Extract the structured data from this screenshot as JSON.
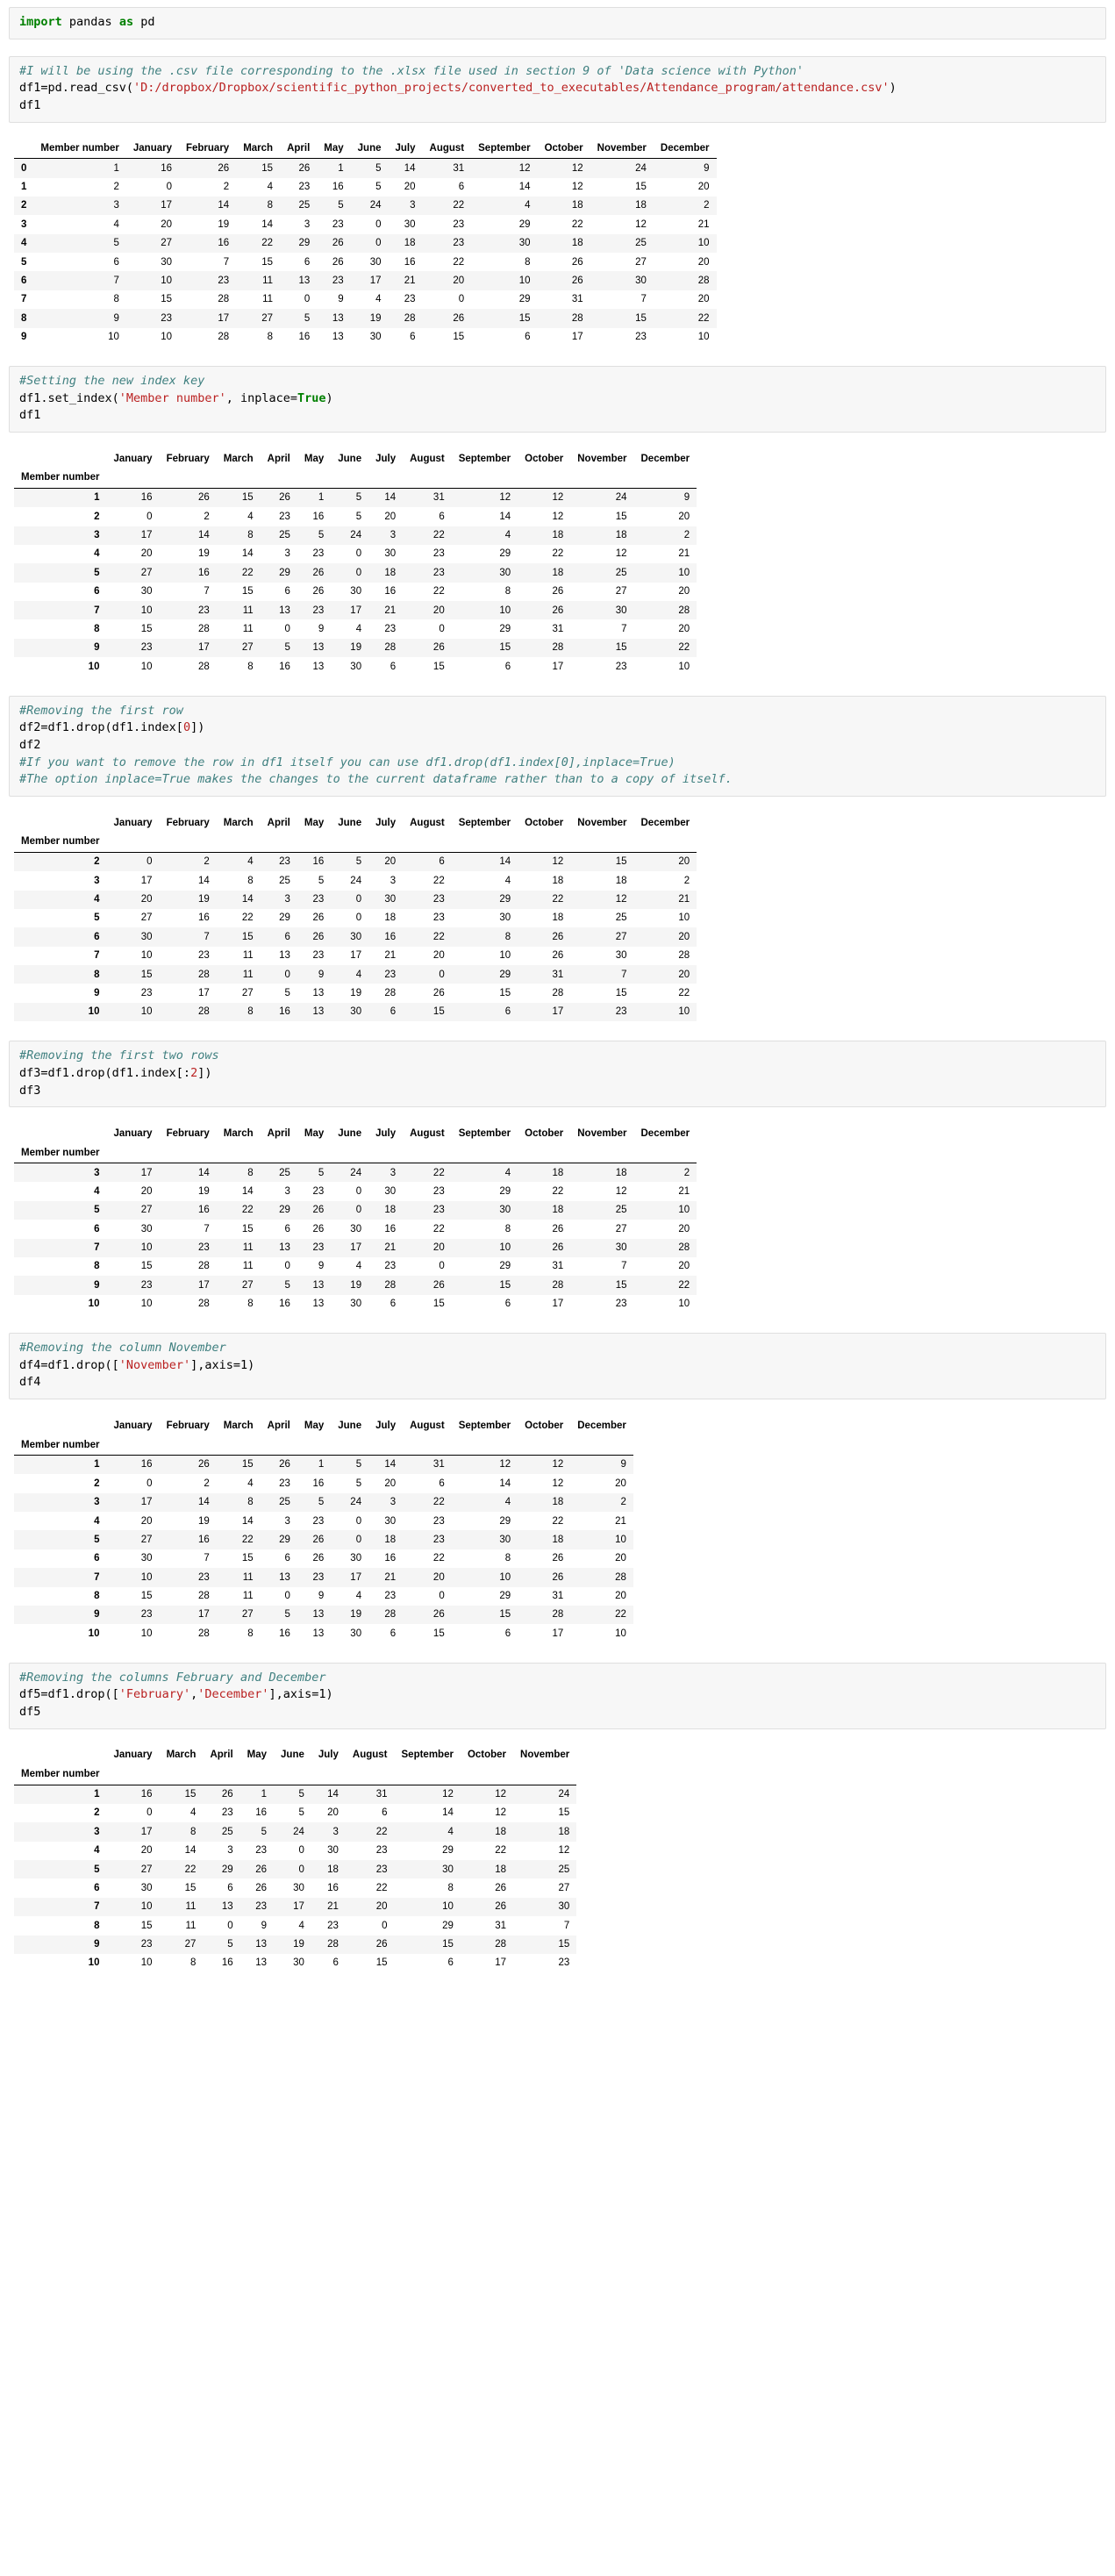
{
  "cells": [
    {
      "id": "cell-import",
      "lines": [
        {
          "segments": [
            {
              "t": "import",
              "c": "kw"
            },
            {
              "t": " pandas ",
              "c": ""
            },
            {
              "t": "as",
              "c": "kw"
            },
            {
              "t": " pd",
              "c": ""
            }
          ]
        }
      ]
    },
    {
      "id": "cell-readcsv",
      "lines": [
        {
          "segments": [
            {
              "t": "#I will be using the .csv file corresponding to the .xlsx file used in section 9 of 'Data science with Python'",
              "c": "cm"
            }
          ]
        },
        {
          "segments": [
            {
              "t": "df1=pd.read_csv(",
              "c": ""
            },
            {
              "t": "'D:/dropbox/Dropbox/scientific_python_projects/converted_to_executables/Attendance_program/attendance.csv'",
              "c": "st"
            },
            {
              "t": ")",
              "c": ""
            }
          ]
        },
        {
          "segments": [
            {
              "t": "df1",
              "c": ""
            }
          ]
        }
      ]
    },
    {
      "id": "cell-setindex",
      "lines": [
        {
          "segments": [
            {
              "t": "#Setting the new index key",
              "c": "cm"
            }
          ]
        },
        {
          "segments": [
            {
              "t": "df1.set_index(",
              "c": ""
            },
            {
              "t": "'Member number'",
              "c": "st"
            },
            {
              "t": ", inplace=",
              "c": ""
            },
            {
              "t": "True",
              "c": "kw"
            },
            {
              "t": ")",
              "c": ""
            }
          ]
        },
        {
          "segments": [
            {
              "t": "df1",
              "c": ""
            }
          ]
        }
      ]
    },
    {
      "id": "cell-droprow",
      "lines": [
        {
          "segments": [
            {
              "t": "#Removing the first row",
              "c": "cm"
            }
          ]
        },
        {
          "segments": [
            {
              "t": "df2=df1.drop(df1.index[",
              "c": ""
            },
            {
              "t": "0",
              "c": "st"
            },
            {
              "t": "])",
              "c": ""
            }
          ]
        },
        {
          "segments": [
            {
              "t": "df2",
              "c": ""
            }
          ]
        },
        {
          "segments": [
            {
              "t": "#If you want to remove the row in df1 itself you can use df1.drop(df1.index[0],inplace=True)",
              "c": "cm"
            }
          ]
        },
        {
          "segments": [
            {
              "t": "#The option inplace=True makes the changes to the current dataframe rather than to a copy of itself.",
              "c": "cm"
            }
          ]
        }
      ]
    },
    {
      "id": "cell-droptworows",
      "lines": [
        {
          "segments": [
            {
              "t": "#Removing the first two rows",
              "c": "cm"
            }
          ]
        },
        {
          "segments": [
            {
              "t": "df3=df1.drop(df1.index[:",
              "c": ""
            },
            {
              "t": "2",
              "c": "st"
            },
            {
              "t": "])",
              "c": ""
            }
          ]
        },
        {
          "segments": [
            {
              "t": "df3",
              "c": ""
            }
          ]
        }
      ]
    },
    {
      "id": "cell-dropcol",
      "lines": [
        {
          "segments": [
            {
              "t": "#Removing the column November",
              "c": "cm"
            }
          ]
        },
        {
          "segments": [
            {
              "t": "df4=df1.drop([",
              "c": ""
            },
            {
              "t": "'November'",
              "c": "st"
            },
            {
              "t": "],axis=1)",
              "c": ""
            }
          ]
        },
        {
          "segments": [
            {
              "t": "df4",
              "c": ""
            }
          ]
        }
      ]
    },
    {
      "id": "cell-droptwocols",
      "lines": [
        {
          "segments": [
            {
              "t": "#Removing the columns February and December",
              "c": "cm"
            }
          ]
        },
        {
          "segments": [
            {
              "t": "df5=df1.drop([",
              "c": ""
            },
            {
              "t": "'February'",
              "c": "st"
            },
            {
              "t": ",",
              "c": ""
            },
            {
              "t": "'December'",
              "c": "st"
            },
            {
              "t": "],axis=1)",
              "c": ""
            }
          ]
        },
        {
          "segments": [
            {
              "t": "df5",
              "c": ""
            }
          ]
        }
      ]
    }
  ],
  "tables": [
    {
      "id": "df1-raw",
      "index_name": null,
      "columns": [
        "Member number",
        "January",
        "February",
        "March",
        "April",
        "May",
        "June",
        "July",
        "August",
        "September",
        "October",
        "November",
        "December"
      ],
      "index": [
        "0",
        "1",
        "2",
        "3",
        "4",
        "5",
        "6",
        "7",
        "8",
        "9"
      ],
      "rows": [
        [
          1,
          16,
          26,
          15,
          26,
          1,
          5,
          14,
          31,
          12,
          12,
          24,
          9
        ],
        [
          2,
          0,
          2,
          4,
          23,
          16,
          5,
          20,
          6,
          14,
          12,
          15,
          20
        ],
        [
          3,
          17,
          14,
          8,
          25,
          5,
          24,
          3,
          22,
          4,
          18,
          18,
          2
        ],
        [
          4,
          20,
          19,
          14,
          3,
          23,
          0,
          30,
          23,
          29,
          22,
          12,
          21
        ],
        [
          5,
          27,
          16,
          22,
          29,
          26,
          0,
          18,
          23,
          30,
          18,
          25,
          10
        ],
        [
          6,
          30,
          7,
          15,
          6,
          26,
          30,
          16,
          22,
          8,
          26,
          27,
          20
        ],
        [
          7,
          10,
          23,
          11,
          13,
          23,
          17,
          21,
          20,
          10,
          26,
          30,
          28
        ],
        [
          8,
          15,
          28,
          11,
          0,
          9,
          4,
          23,
          0,
          29,
          31,
          7,
          20
        ],
        [
          9,
          23,
          17,
          27,
          5,
          13,
          19,
          28,
          26,
          15,
          28,
          15,
          22
        ],
        [
          10,
          10,
          28,
          8,
          16,
          13,
          30,
          6,
          15,
          6,
          17,
          23,
          10
        ]
      ]
    },
    {
      "id": "df1-indexed",
      "index_name": "Member number",
      "columns": [
        "January",
        "February",
        "March",
        "April",
        "May",
        "June",
        "July",
        "August",
        "September",
        "October",
        "November",
        "December"
      ],
      "index": [
        "1",
        "2",
        "3",
        "4",
        "5",
        "6",
        "7",
        "8",
        "9",
        "10"
      ],
      "rows": [
        [
          16,
          26,
          15,
          26,
          1,
          5,
          14,
          31,
          12,
          12,
          24,
          9
        ],
        [
          0,
          2,
          4,
          23,
          16,
          5,
          20,
          6,
          14,
          12,
          15,
          20
        ],
        [
          17,
          14,
          8,
          25,
          5,
          24,
          3,
          22,
          4,
          18,
          18,
          2
        ],
        [
          20,
          19,
          14,
          3,
          23,
          0,
          30,
          23,
          29,
          22,
          12,
          21
        ],
        [
          27,
          16,
          22,
          29,
          26,
          0,
          18,
          23,
          30,
          18,
          25,
          10
        ],
        [
          30,
          7,
          15,
          6,
          26,
          30,
          16,
          22,
          8,
          26,
          27,
          20
        ],
        [
          10,
          23,
          11,
          13,
          23,
          17,
          21,
          20,
          10,
          26,
          30,
          28
        ],
        [
          15,
          28,
          11,
          0,
          9,
          4,
          23,
          0,
          29,
          31,
          7,
          20
        ],
        [
          23,
          17,
          27,
          5,
          13,
          19,
          28,
          26,
          15,
          28,
          15,
          22
        ],
        [
          10,
          28,
          8,
          16,
          13,
          30,
          6,
          15,
          6,
          17,
          23,
          10
        ]
      ]
    },
    {
      "id": "df2",
      "index_name": "Member number",
      "columns": [
        "January",
        "February",
        "March",
        "April",
        "May",
        "June",
        "July",
        "August",
        "September",
        "October",
        "November",
        "December"
      ],
      "index": [
        "2",
        "3",
        "4",
        "5",
        "6",
        "7",
        "8",
        "9",
        "10"
      ],
      "rows": [
        [
          0,
          2,
          4,
          23,
          16,
          5,
          20,
          6,
          14,
          12,
          15,
          20
        ],
        [
          17,
          14,
          8,
          25,
          5,
          24,
          3,
          22,
          4,
          18,
          18,
          2
        ],
        [
          20,
          19,
          14,
          3,
          23,
          0,
          30,
          23,
          29,
          22,
          12,
          21
        ],
        [
          27,
          16,
          22,
          29,
          26,
          0,
          18,
          23,
          30,
          18,
          25,
          10
        ],
        [
          30,
          7,
          15,
          6,
          26,
          30,
          16,
          22,
          8,
          26,
          27,
          20
        ],
        [
          10,
          23,
          11,
          13,
          23,
          17,
          21,
          20,
          10,
          26,
          30,
          28
        ],
        [
          15,
          28,
          11,
          0,
          9,
          4,
          23,
          0,
          29,
          31,
          7,
          20
        ],
        [
          23,
          17,
          27,
          5,
          13,
          19,
          28,
          26,
          15,
          28,
          15,
          22
        ],
        [
          10,
          28,
          8,
          16,
          13,
          30,
          6,
          15,
          6,
          17,
          23,
          10
        ]
      ]
    },
    {
      "id": "df3",
      "index_name": "Member number",
      "columns": [
        "January",
        "February",
        "March",
        "April",
        "May",
        "June",
        "July",
        "August",
        "September",
        "October",
        "November",
        "December"
      ],
      "index": [
        "3",
        "4",
        "5",
        "6",
        "7",
        "8",
        "9",
        "10"
      ],
      "rows": [
        [
          17,
          14,
          8,
          25,
          5,
          24,
          3,
          22,
          4,
          18,
          18,
          2
        ],
        [
          20,
          19,
          14,
          3,
          23,
          0,
          30,
          23,
          29,
          22,
          12,
          21
        ],
        [
          27,
          16,
          22,
          29,
          26,
          0,
          18,
          23,
          30,
          18,
          25,
          10
        ],
        [
          30,
          7,
          15,
          6,
          26,
          30,
          16,
          22,
          8,
          26,
          27,
          20
        ],
        [
          10,
          23,
          11,
          13,
          23,
          17,
          21,
          20,
          10,
          26,
          30,
          28
        ],
        [
          15,
          28,
          11,
          0,
          9,
          4,
          23,
          0,
          29,
          31,
          7,
          20
        ],
        [
          23,
          17,
          27,
          5,
          13,
          19,
          28,
          26,
          15,
          28,
          15,
          22
        ],
        [
          10,
          28,
          8,
          16,
          13,
          30,
          6,
          15,
          6,
          17,
          23,
          10
        ]
      ]
    },
    {
      "id": "df4",
      "index_name": "Member number",
      "columns": [
        "January",
        "February",
        "March",
        "April",
        "May",
        "June",
        "July",
        "August",
        "September",
        "October",
        "December"
      ],
      "index": [
        "1",
        "2",
        "3",
        "4",
        "5",
        "6",
        "7",
        "8",
        "9",
        "10"
      ],
      "rows": [
        [
          16,
          26,
          15,
          26,
          1,
          5,
          14,
          31,
          12,
          12,
          9
        ],
        [
          0,
          2,
          4,
          23,
          16,
          5,
          20,
          6,
          14,
          12,
          20
        ],
        [
          17,
          14,
          8,
          25,
          5,
          24,
          3,
          22,
          4,
          18,
          2
        ],
        [
          20,
          19,
          14,
          3,
          23,
          0,
          30,
          23,
          29,
          22,
          21
        ],
        [
          27,
          16,
          22,
          29,
          26,
          0,
          18,
          23,
          30,
          18,
          10
        ],
        [
          30,
          7,
          15,
          6,
          26,
          30,
          16,
          22,
          8,
          26,
          20
        ],
        [
          10,
          23,
          11,
          13,
          23,
          17,
          21,
          20,
          10,
          26,
          28
        ],
        [
          15,
          28,
          11,
          0,
          9,
          4,
          23,
          0,
          29,
          31,
          20
        ],
        [
          23,
          17,
          27,
          5,
          13,
          19,
          28,
          26,
          15,
          28,
          22
        ],
        [
          10,
          28,
          8,
          16,
          13,
          30,
          6,
          15,
          6,
          17,
          10
        ]
      ]
    },
    {
      "id": "df5",
      "index_name": "Member number",
      "columns": [
        "January",
        "March",
        "April",
        "May",
        "June",
        "July",
        "August",
        "September",
        "October",
        "November"
      ],
      "index": [
        "1",
        "2",
        "3",
        "4",
        "5",
        "6",
        "7",
        "8",
        "9",
        "10"
      ],
      "rows": [
        [
          16,
          15,
          26,
          1,
          5,
          14,
          31,
          12,
          12,
          24
        ],
        [
          0,
          4,
          23,
          16,
          5,
          20,
          6,
          14,
          12,
          15
        ],
        [
          17,
          8,
          25,
          5,
          24,
          3,
          22,
          4,
          18,
          18
        ],
        [
          20,
          14,
          3,
          23,
          0,
          30,
          23,
          29,
          22,
          12
        ],
        [
          27,
          22,
          29,
          26,
          0,
          18,
          23,
          30,
          18,
          25
        ],
        [
          30,
          15,
          6,
          26,
          30,
          16,
          22,
          8,
          26,
          27
        ],
        [
          10,
          11,
          13,
          23,
          17,
          21,
          20,
          10,
          26,
          30
        ],
        [
          15,
          11,
          0,
          9,
          4,
          23,
          0,
          29,
          31,
          7
        ],
        [
          23,
          27,
          5,
          13,
          19,
          28,
          26,
          15,
          28,
          15
        ],
        [
          10,
          8,
          16,
          13,
          30,
          6,
          15,
          6,
          17,
          23
        ]
      ]
    }
  ],
  "layout_order": [
    {
      "type": "cell",
      "ref": 0
    },
    {
      "type": "cell",
      "ref": 1
    },
    {
      "type": "table",
      "ref": 0
    },
    {
      "type": "cell",
      "ref": 2
    },
    {
      "type": "table",
      "ref": 1
    },
    {
      "type": "cell",
      "ref": 3
    },
    {
      "type": "table",
      "ref": 2
    },
    {
      "type": "cell",
      "ref": 4
    },
    {
      "type": "table",
      "ref": 3
    },
    {
      "type": "cell",
      "ref": 5
    },
    {
      "type": "table",
      "ref": 4
    },
    {
      "type": "cell",
      "ref": 6
    },
    {
      "type": "table",
      "ref": 5
    }
  ],
  "colors": {
    "keyword": "#008000",
    "comment": "#408080",
    "string": "#BA2121",
    "cell_bg": "#f7f7f7",
    "cell_border": "#dfdfdf",
    "row_stripe": "#f5f5f5"
  }
}
